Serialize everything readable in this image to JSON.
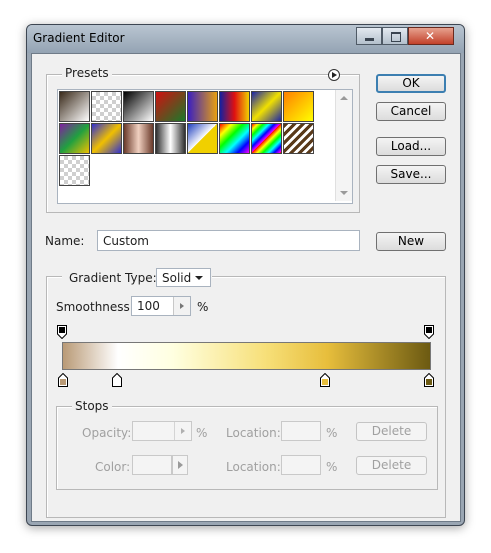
{
  "window": {
    "title": "Gradient Editor"
  },
  "presets": {
    "label": "Presets",
    "swatches": [
      "linear-gradient(135deg,#3a2a1a,#ffffff)",
      "checker",
      "linear-gradient(135deg,#000,#fff)",
      "linear-gradient(135deg,#d01010,#1a7a2a)",
      "linear-gradient(90deg,#3a20c0,#e8a010)",
      "linear-gradient(90deg,#1420a0,#e01010,#f0d000)",
      "linear-gradient(135deg,#1a24a8,#f0e000,#1a24a8)",
      "linear-gradient(135deg,#ff8000,#ffff00)",
      "linear-gradient(135deg,#8020a0,#20a040,#f0c000)",
      "linear-gradient(135deg,#3030d0,#f0c000,#3030d0)",
      "linear-gradient(90deg,#6a3a2a,#f0d0c0,#6a3a2a)",
      "linear-gradient(90deg,#303030,#ffffff,#303030)",
      "linear-gradient(135deg,#2040c0,#ffffff 50%,#f0d000 50%)",
      "linear-gradient(135deg,#ff0000,#ffff00,#00ff00,#00ffff,#0000ff,#ff00ff)",
      "repeating-linear-gradient(135deg,#ff0000 0,#ffff00 4px,#00ff00 8px,#00ffff 12px,#0000ff 16px,#ff00ff 20px)",
      "repeating-linear-gradient(135deg,#5a3a1a 0 3px,#ffffff 3px 6px)",
      "checker"
    ]
  },
  "buttons": {
    "ok": "OK",
    "cancel": "Cancel",
    "load": "Load...",
    "save": "Save...",
    "new": "New"
  },
  "name": {
    "label": "Name:",
    "value": "Custom"
  },
  "gradient_type": {
    "label": "Gradient Type:",
    "value": "Solid"
  },
  "smoothness": {
    "label": "Smoothness:",
    "value": "100",
    "unit": "%"
  },
  "stops": {
    "label": "Stops",
    "opacity_label": "Opacity:",
    "opacity_unit": "%",
    "location1_label": "Location:",
    "location1_unit": "%",
    "delete1": "Delete",
    "color_label": "Color:",
    "location2_label": "Location:",
    "location2_unit": "%",
    "delete2": "Delete"
  },
  "colors": {
    "stop_tan": "#b99a76",
    "stop_white": "#ffffff",
    "stop_gold": "#e7be3c",
    "stop_olive": "#6c5a12",
    "accent": "#3c7fb1"
  }
}
